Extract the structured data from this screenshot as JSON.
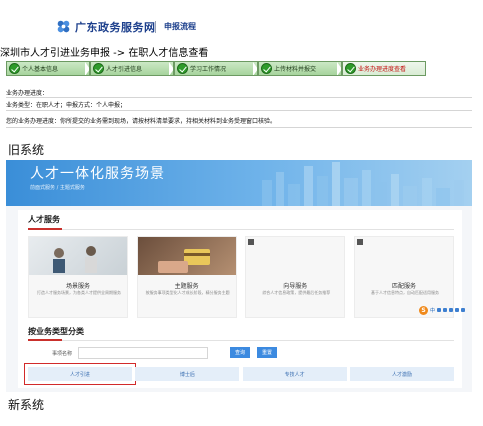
{
  "old_system": {
    "portal_name": "广东政务服务网",
    "header_subtitle": "申报流程",
    "breadcrumb": "深圳市人才引进业务申报 -> 在职人才信息查看",
    "steps": [
      {
        "label": "个人基本信息",
        "active": false
      },
      {
        "label": "人才引进信息",
        "active": false
      },
      {
        "label": "学习工作情况",
        "active": false
      },
      {
        "label": "上传材料并报交",
        "active": false
      },
      {
        "label": "业务办理进度查看",
        "active": true
      }
    ],
    "progress_heading": "业务办理进度：",
    "business_info": "业务类型：在职人才；申报方式：个人申报；",
    "progress_message": "您的业务办理进度：你所提交的业务需到现场，请按材料清单要求，持相关材料到业务受理窗口核验。",
    "caption": "旧系统"
  },
  "new_system": {
    "banner_title": "人才一体化服务场景",
    "banner_breadcrumb": "前面式服务 / 主题式服务",
    "services_title": "人才服务",
    "service_cards": [
      {
        "name": "场景服务",
        "desc": "打造人才服务场景，为各类人才提供全周期服务"
      },
      {
        "name": "主题服务",
        "desc": "按服务事项类型化人才成长阶段，精分服务主题"
      },
      {
        "name": "向导服务",
        "desc": "综合人才信息政策，提供最后任务推荐"
      },
      {
        "name": "匹配服务",
        "desc": "基于人才信息特点，自动匹配适用服务"
      }
    ],
    "floating_toolbar": {
      "badge": "S",
      "label": "中"
    },
    "category_title": "按业务类型分类",
    "search_label": "事项名称",
    "search_placeholder": "",
    "query_button": "查询",
    "reset_button": "重置",
    "category_tabs": [
      {
        "label": "人才引进",
        "selected": true
      },
      {
        "label": "博士后",
        "selected": false
      },
      {
        "label": "专技人才",
        "selected": false
      },
      {
        "label": "人才激励",
        "selected": false
      }
    ],
    "caption": "新系统"
  },
  "colors": {
    "step_done": "#a7d49d",
    "step_active_text": "#c41212",
    "banner_blue": "#3a8ed8",
    "accent_red": "#c9302c",
    "button_blue": "#3c8ae0",
    "tab_bg": "#e4eef9"
  }
}
